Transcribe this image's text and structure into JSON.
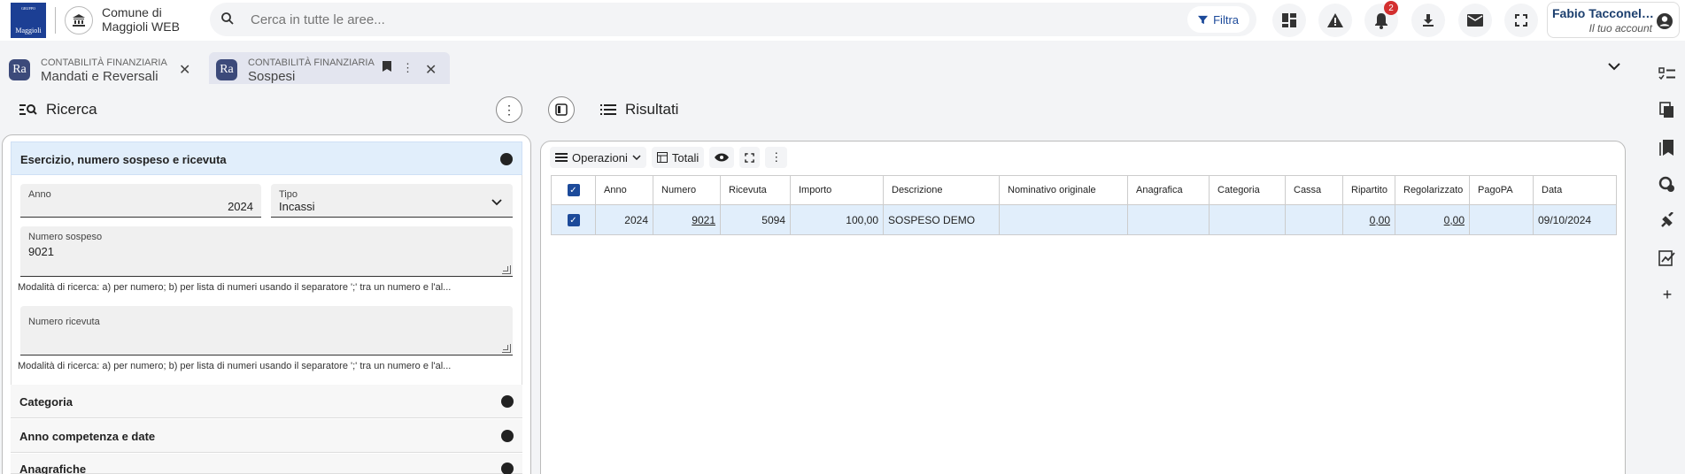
{
  "header": {
    "logo_text": "Maggioli",
    "logo_small": "GRUPPO",
    "app_title_line1": "Comune di",
    "app_title_line2": "Maggioli WEB",
    "search_placeholder": "Cerca in tutte le aree...",
    "filter_label": "Filtra",
    "notification_count": "2",
    "account_name": "Fabio Tacconell...",
    "account_sub": "Il tuo account",
    "icons": [
      "dashboard-icon",
      "warning-icon",
      "bell-icon",
      "download-icon",
      "mail-icon",
      "fullscreen-icon",
      "account-icon"
    ]
  },
  "tabs": [
    {
      "category": "CONTABILITÀ FINANZIARIA",
      "name": "Mandati e Reversali",
      "avatar": "Ra"
    },
    {
      "category": "CONTABILITÀ FINANZIARIA",
      "name": "Sospesi",
      "avatar": "Ra"
    }
  ],
  "left": {
    "title": "Ricerca",
    "section_open": "Esercizio, numero sospeso e ricevuta",
    "anno_label": "Anno",
    "anno_value": "2024",
    "tipo_label": "Tipo",
    "tipo_value": "Incassi",
    "numero_sospeso_label": "Numero sospeso",
    "numero_sospeso_value": "9021",
    "hint1": "Modalità di ricerca: a) per numero; b) per lista di numeri usando il separatore ';' tra un numero e l'al...",
    "numero_ricevuta_label": "Numero ricevuta",
    "hint2": "Modalità di ricerca: a) per numero; b) per lista di numeri usando il separatore ';' tra un numero e l'al...",
    "sections_closed": [
      "Categoria",
      "Anno competenza e date",
      "Anagrafiche"
    ]
  },
  "right": {
    "title": "Risultati",
    "toolbar": {
      "operazioni": "Operazioni",
      "totali": "Totali"
    },
    "columns": [
      "Anno",
      "Numero",
      "Ricevuta",
      "Importo",
      "Descrizione",
      "Nominativo originale",
      "Anagrafica",
      "Categoria",
      "Cassa",
      "Ripartito",
      "Regolarizzato",
      "PagoPA",
      "Data"
    ],
    "rows": [
      {
        "anno": "2024",
        "numero": "9021",
        "ricevuta": "5094",
        "importo": "100,00",
        "descrizione": "SOSPESO DEMO",
        "nominativo": "",
        "anagrafica": "",
        "categoria": "",
        "cassa": "",
        "ripartito": "0,00",
        "regolarizzato": "0,00",
        "pagopa": "",
        "data": "09/10/2024"
      }
    ]
  }
}
